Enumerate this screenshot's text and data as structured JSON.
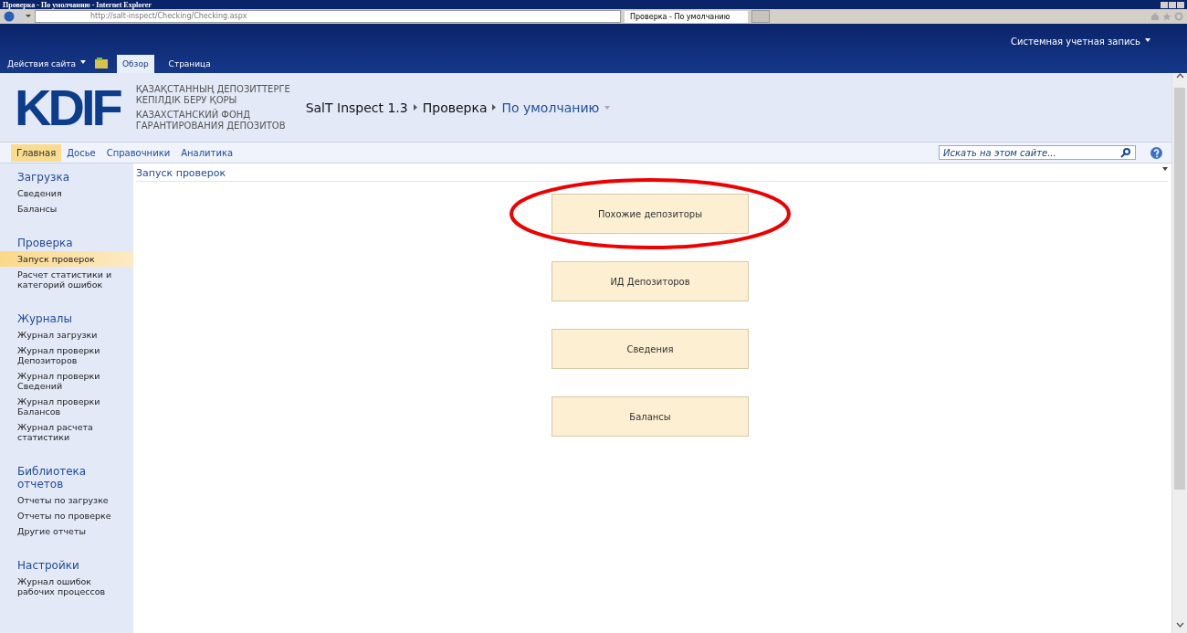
{
  "window": {
    "title": "Проверка - По умолчанию - Internet Explorer"
  },
  "browser": {
    "address": "http://salt-inspect/Checking/Checking.aspx",
    "tabs": [
      {
        "label": "Проверка - По умолчанию",
        "selected": true
      }
    ]
  },
  "ribbon": {
    "site_actions": "Действия сайта",
    "tabs": [
      {
        "label": "Обзор",
        "selected": true
      },
      {
        "label": "Страница",
        "selected": false
      }
    ],
    "account": "Системная учетная запись"
  },
  "header": {
    "logo": "KDIF",
    "org_lines": [
      "ҚАЗАҚСТАННЫҢ ДЕПОЗИТТЕРГЕ",
      "КЕПІЛДІК БЕРУ ҚОРЫ",
      "КАЗАХСТАНСКИЙ ФОНД",
      "ГАРАНТИРОВАНИЯ ДЕПОЗИТОВ"
    ],
    "breadcrumb": [
      "SalT Inspect 1.3",
      "Проверка",
      "По умолчанию"
    ]
  },
  "top_nav": {
    "items": [
      {
        "label": "Главная",
        "selected": true
      },
      {
        "label": "Досье",
        "selected": false
      },
      {
        "label": "Справочники",
        "selected": false
      },
      {
        "label": "Аналитика",
        "selected": false
      }
    ],
    "search": {
      "placeholder": "Искать на этом сайте..."
    }
  },
  "sidebar": {
    "sections": [
      {
        "title": "Загрузка",
        "items": [
          {
            "label": "Сведения",
            "selected": false
          },
          {
            "label": "Балансы",
            "selected": false
          }
        ]
      },
      {
        "title": "Проверка",
        "items": [
          {
            "label": "Запуск проверок",
            "selected": true
          },
          {
            "label": "Расчет статистики и категорий ошибок",
            "selected": false
          }
        ]
      },
      {
        "title": "Журналы",
        "items": [
          {
            "label": "Журнал загрузки",
            "selected": false
          },
          {
            "label": "Журнал проверки Депозиторов",
            "selected": false
          },
          {
            "label": "Журнал проверки Сведений",
            "selected": false
          },
          {
            "label": "Журнал проверки Балансов",
            "selected": false
          },
          {
            "label": "Журнал расчета статистики",
            "selected": false
          }
        ]
      },
      {
        "title": "Библиотека отчетов",
        "items": [
          {
            "label": "Отчеты по загрузке",
            "selected": false
          },
          {
            "label": "Отчеты по проверке",
            "selected": false
          },
          {
            "label": "Другие отчеты",
            "selected": false
          }
        ]
      },
      {
        "title": "Настройки",
        "items": [
          {
            "label": "Журнал ошибок рабочих процессов",
            "selected": false
          }
        ]
      }
    ]
  },
  "main": {
    "title": "Запуск проверок",
    "buttons": [
      {
        "label": "Похожие депозиторы",
        "highlighted": true
      },
      {
        "label": "ИД Депозиторов",
        "highlighted": false
      },
      {
        "label": "Сведения",
        "highlighted": false
      },
      {
        "label": "Балансы",
        "highlighted": false
      }
    ]
  }
}
